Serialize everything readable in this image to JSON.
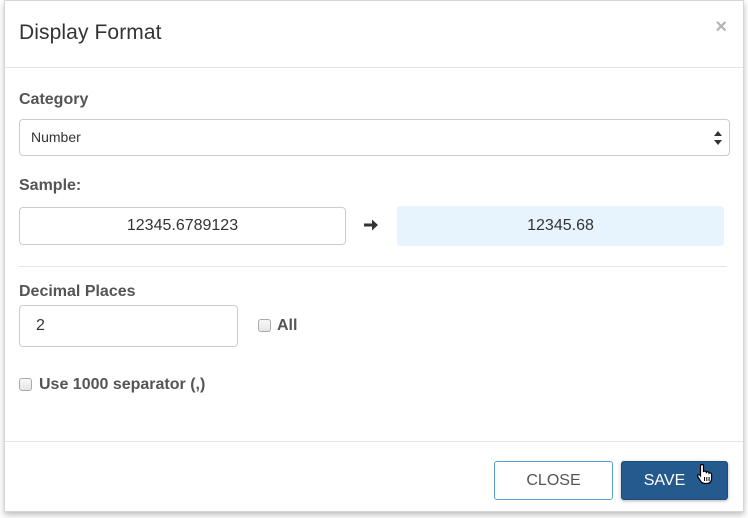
{
  "dialog": {
    "title": "Display Format",
    "close_icon": "close-x-icon"
  },
  "category": {
    "label": "Category",
    "selected": "Number",
    "icon": "select-arrows-icon"
  },
  "sample": {
    "label": "Sample:",
    "input_value": "12345.6789123",
    "arrow_icon": "arrow-right-icon",
    "output_value": "12345.68"
  },
  "decimal_places": {
    "label": "Decimal Places",
    "value": "2",
    "all_checkbox": {
      "label": "All",
      "checked": false
    }
  },
  "separator": {
    "label": "Use 1000 separator (,)",
    "checked": false
  },
  "footer": {
    "close_label": "CLOSE",
    "save_label": "SAVE"
  },
  "colors": {
    "primary": "#255a8e",
    "close_border": "#5a9fd4",
    "sample_output_bg": "#e8f4fd"
  },
  "cursor": "hand-pointer-icon"
}
